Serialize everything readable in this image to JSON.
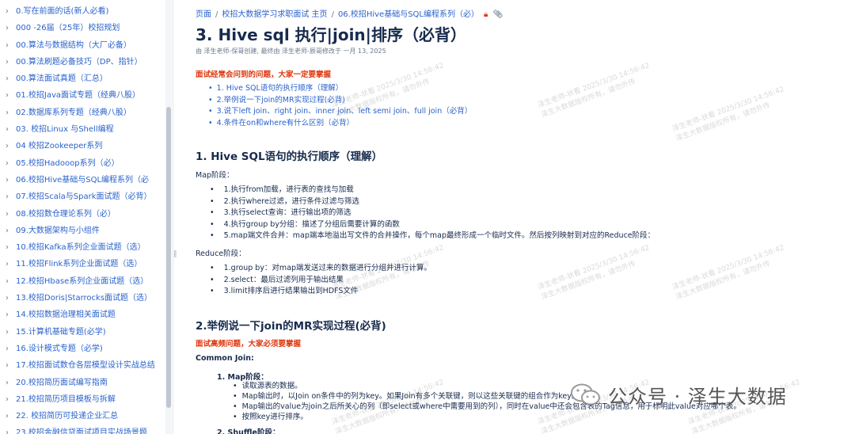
{
  "sidebar": {
    "items": [
      {
        "label": "0.写在前面的话(新人必看)"
      },
      {
        "label": "000 -26届（25年）校招规划"
      },
      {
        "label": "00.算法与数据结构（大厂必备）"
      },
      {
        "label": "00.算法刷题必备技巧（DP、指针）"
      },
      {
        "label": "00.算法面试真题（汇总）"
      },
      {
        "label": "01.校招Java面试专题（经典八股）"
      },
      {
        "label": "02.数据库系列专题（经典八股）"
      },
      {
        "label": "03. 校招Linux 与Shell编程"
      },
      {
        "label": "04 校招Zookeeper系列"
      },
      {
        "label": "05.校招Hadooop系列（必）"
      },
      {
        "label": "06.校招Hive基础与SQL编程系列（必"
      },
      {
        "label": "07.校招Scala与Spark面试题（必背）"
      },
      {
        "label": "08.校招数仓理论系列（必）"
      },
      {
        "label": "09.大数据架构与小组件"
      },
      {
        "label": "10.校招Kafka系列企业面试题（选）"
      },
      {
        "label": "11.校招Flink系列企业面试题（选）"
      },
      {
        "label": "12.校招Hbase系列企业面试题（选）"
      },
      {
        "label": "13.校招Doris|Starrocks面试题（选）"
      },
      {
        "label": "14.校招数据治理相关面试题"
      },
      {
        "label": "15.计算机基础专题(必学)"
      },
      {
        "label": "16.设计模式专题（必学)"
      },
      {
        "label": "17.校招面试数仓各层模型设计实战总结"
      },
      {
        "label": "20.校招简历面试编写指南"
      },
      {
        "label": "21.校招简历项目模板与拆解"
      },
      {
        "label": "22. 校招简历可投递企业汇总"
      },
      {
        "label": "23.校招金融信贷面试项目实战场景题"
      }
    ]
  },
  "breadcrumb": {
    "items": [
      "页面",
      "校招大数据学习求职面试 主页",
      "06.校招Hive基础与SQL编程系列（必）"
    ],
    "lock_icon": "lock-icon",
    "attachment_icon": "paperclip-icon"
  },
  "page": {
    "title": "3. Hive sql 执行|join|排序（必背）",
    "meta": "由 泽生老师-保哥创建, 最终由 泽生老师-辰哥修改于 一月 13, 2025",
    "intro_note": "面试经常会问到的问题，大家一定要掌握",
    "toc": [
      "1. Hive SQL语句的执行顺序（理解）",
      "2.举例说一下join的MR实现过程(必背)",
      "3.说下left join、right join、inner join、left semi join、full join（必背）",
      "4.条件在on和where有什么区别（必背）"
    ],
    "s1": {
      "heading": "1. Hive SQL语句的执行顺序（理解）",
      "map_label": "Map阶段：",
      "map_items": [
        "1.执行from加载，进行表的查找与加载",
        "2.执行where过滤，进行条件过滤与筛选",
        "3.执行select查询：进行输出项的筛选",
        "4.执行group by分组：描述了分组后需要计算的函数",
        "5.map端文件合并：map端本地溢出写文件的合并操作，每个map最终形成一个临时文件。然后按列映射到对应的Reduce阶段："
      ],
      "reduce_label": "Reduce阶段：",
      "reduce_items": [
        "1.group by：对map端发送过来的数据进行分组并进行计算。",
        "2.select：最后过滤列用于输出结果",
        "3.limit排序后进行结果输出到HDFS文件"
      ]
    },
    "s2": {
      "heading": "2.举例说一下join的MR实现过程(必背)",
      "note": "面试高频问题，大家必须要掌握",
      "common_join": "Common Join:",
      "map_phase": "1. Map阶段：",
      "map_sub": [
        "读取源表的数据。",
        "Map输出时，以Join on条件中的列为key。如果Join有多个关联键，则以这些关联键的组合作为key。",
        "Map输出的value为join之后所关心的列（即select或where中需要用到的列），同时在value中还会包含表的Tag信息，用于标明此value对应哪个表。",
        "按照key进行排序。"
      ],
      "shuffle_phase": "2. Shuffle阶段："
    }
  },
  "watermark": {
    "text": "泽生老师-状看 2025/3/30 14:56:42",
    "text2": "泽生大数据版权所有，请勿外传"
  },
  "wechat": {
    "text": "公众号 · 泽生大数据",
    "icon": "wechat-icon"
  }
}
